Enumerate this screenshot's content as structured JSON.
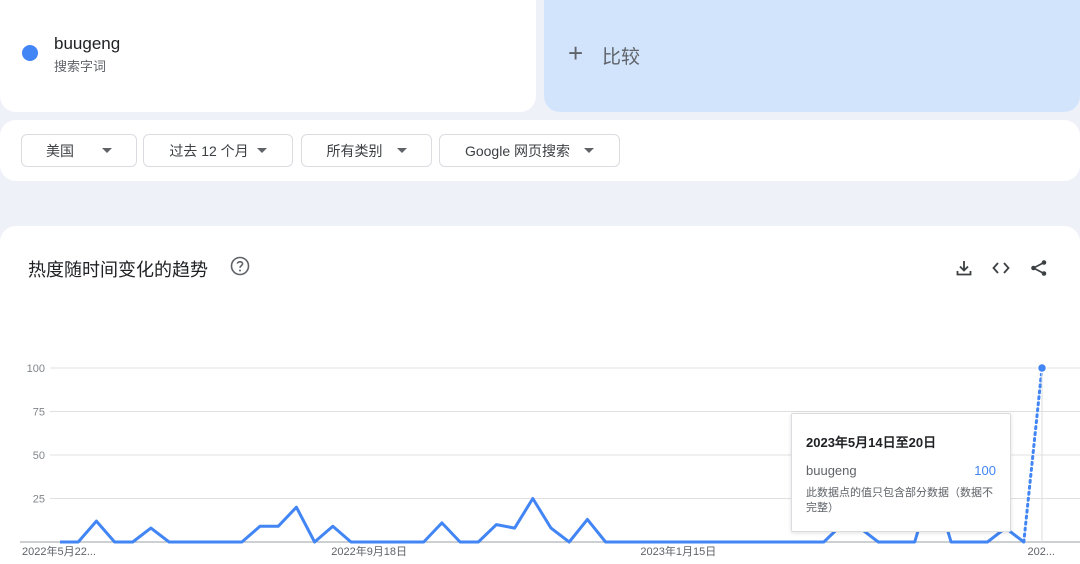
{
  "search_term": {
    "name": "buugeng",
    "sublabel": "搜索字词",
    "color": "#4285f4"
  },
  "compare": {
    "plus": "+",
    "label": "比较"
  },
  "filters": [
    {
      "label": "美国"
    },
    {
      "label": "过去 12 个月"
    },
    {
      "label": "所有类别"
    },
    {
      "label": "Google 网页搜索"
    }
  ],
  "chart_section": {
    "title": "热度随时间变化的趋势",
    "icons": [
      "help-icon",
      "download-icon",
      "embed-code-icon",
      "share-icon"
    ]
  },
  "tooltip": {
    "date": "2023年5月14日至20日",
    "term": "buugeng",
    "value": "100",
    "note": "此数据点的值只包含部分数据（数据不完整）"
  },
  "chart_data": {
    "type": "line",
    "yticks": [
      100,
      75,
      50,
      25
    ],
    "ylim": [
      0,
      100
    ],
    "xtick_labels": [
      "2022年5月22...",
      "2022年9月18日",
      "2023年1月15日",
      "202..."
    ],
    "xtick_index": [
      0,
      17,
      34,
      51
    ],
    "grid": true,
    "line_color": "#4285f4",
    "series": [
      {
        "name": "buugeng",
        "values": [
          0,
          0,
          12,
          0,
          0,
          8,
          0,
          0,
          0,
          0,
          0,
          9,
          9,
          20,
          0,
          9,
          0,
          0,
          0,
          0,
          0,
          11,
          0,
          0,
          10,
          8,
          25,
          8,
          0,
          13,
          0,
          0,
          0,
          0,
          0,
          0,
          0,
          0,
          0,
          0,
          0,
          0,
          0,
          10,
          8,
          0,
          0,
          0,
          35,
          0,
          0,
          0,
          8,
          0,
          100
        ],
        "partial_from_index": 53
      }
    ]
  }
}
